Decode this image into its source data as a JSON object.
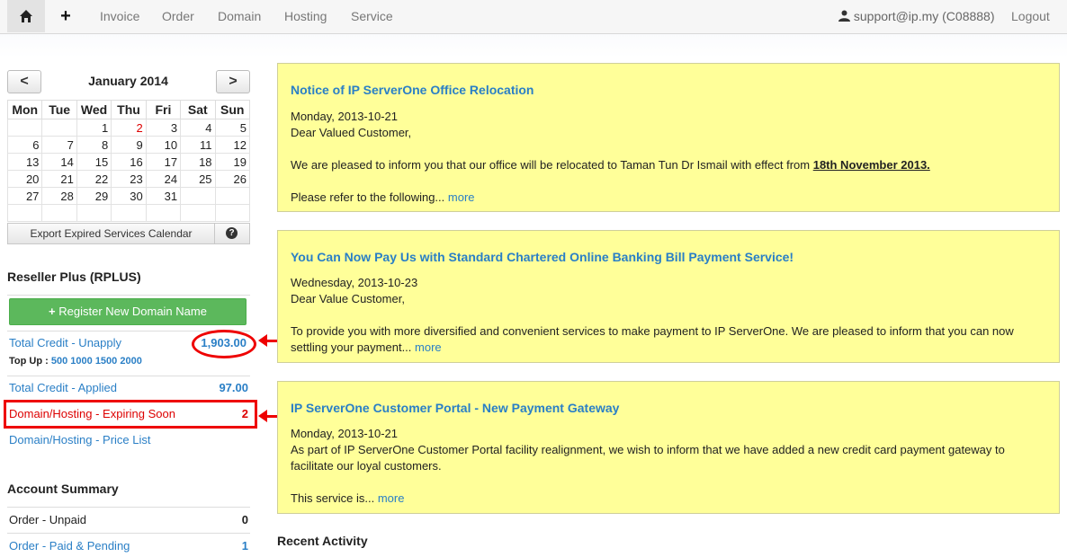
{
  "nav": {
    "home_icon": "home-icon",
    "add_icon": "plus-icon",
    "items": [
      "Invoice",
      "Order",
      "Domain",
      "Hosting",
      "Service"
    ],
    "user_label": "support@ip.my (C08888)",
    "logout": "Logout"
  },
  "calendar": {
    "title": "January 2014",
    "prev": "<",
    "next": ">",
    "weekdays": [
      "Mon",
      "Tue",
      "Wed",
      "Thu",
      "Fri",
      "Sat",
      "Sun"
    ],
    "weeks": [
      [
        "",
        "",
        "1",
        "2",
        "3",
        "4",
        "5"
      ],
      [
        "6",
        "7",
        "8",
        "9",
        "10",
        "11",
        "12"
      ],
      [
        "13",
        "14",
        "15",
        "16",
        "17",
        "18",
        "19"
      ],
      [
        "20",
        "21",
        "22",
        "23",
        "24",
        "25",
        "26"
      ],
      [
        "27",
        "28",
        "29",
        "30",
        "31",
        "",
        ""
      ],
      [
        "",
        "",
        "",
        "",
        "",
        "",
        ""
      ]
    ],
    "highlight_day": "2",
    "export_label": "Export Expired Services Calendar",
    "help_icon": "?"
  },
  "reseller": {
    "title": "Reseller Plus (RPLUS)",
    "register_button": "Register New Domain Name",
    "register_icon": "+",
    "credit_unapply_label": "Total Credit - Unapply",
    "credit_unapply_value": "1,903.00",
    "topup_label": "Top Up :",
    "topup_amounts": [
      "500",
      "1000",
      "1500",
      "2000"
    ],
    "credit_applied_label": "Total Credit - Applied",
    "credit_applied_value": "97.00",
    "expiring_label": "Domain/Hosting - Expiring Soon",
    "expiring_value": "2",
    "price_list_label": "Domain/Hosting - Price List"
  },
  "account": {
    "title": "Account Summary",
    "unpaid_label": "Order - Unpaid",
    "unpaid_value": "0",
    "paid_label": "Order - Paid & Pending",
    "paid_value": "1"
  },
  "announcements": [
    {
      "title": "Notice of IP ServerOne Office Relocation",
      "date": "Monday, 2013-10-21",
      "greeting": "Dear Valued Customer,",
      "body": "We are pleased to inform you that our office will be relocated to Taman Tun Dr Ismail with effect from",
      "body_bold": "18th November 2013.",
      "tail": "Please refer to the following...",
      "more": "more"
    },
    {
      "title": "You Can Now Pay Us with Standard Chartered Online Banking Bill Payment Service!",
      "date": "Wednesday, 2013-10-23",
      "greeting": "Dear Value Customer,",
      "body": "To provide you with more diversified and convenient services to make payment to IP ServerOne.  We are pleased to inform that you can now settling your payment...",
      "more": "more"
    },
    {
      "title": "IP ServerOne Customer Portal - New Payment Gateway",
      "date": "Monday, 2013-10-21",
      "body": "As part of IP ServerOne Customer Portal facility realignment, we wish to inform that we have added a new credit card payment gateway to facilitate our loyal customers.",
      "tail": "This service is...",
      "more": "more"
    }
  ],
  "recent_title": "Recent Activity"
}
